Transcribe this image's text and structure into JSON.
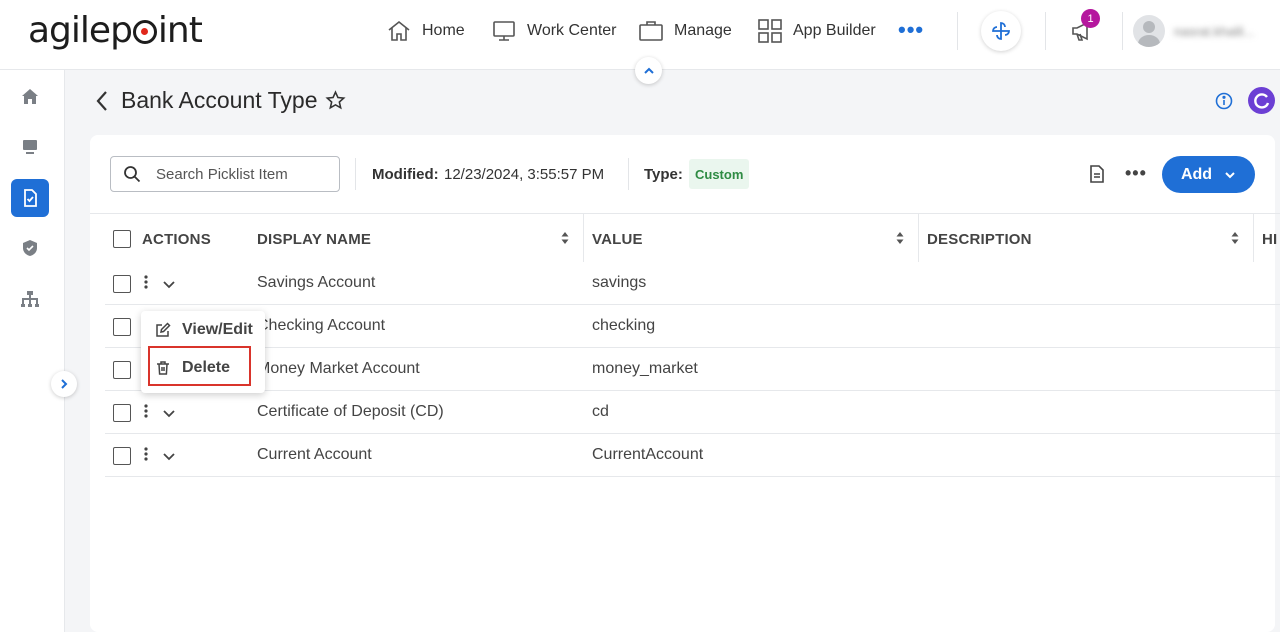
{
  "app": {
    "logo_text": "agilepoint",
    "nav": {
      "home": "Home",
      "work_center": "Work Center",
      "manage": "Manage",
      "app_builder": "App Builder",
      "more": "•••"
    },
    "notification_count": "1",
    "username": "nasrat.khalil..."
  },
  "page": {
    "title": "Bank Account Type",
    "search_placeholder": "Search Picklist Item",
    "modified_label": "Modified:",
    "modified_value": "12/23/2024, 3:55:57 PM",
    "type_label": "Type:",
    "type_value": "Custom",
    "add_label": "Add"
  },
  "table": {
    "headers": {
      "actions": "ACTIONS",
      "display_name": "DISPLAY NAME",
      "value": "VALUE",
      "description": "DESCRIPTION",
      "cutoff": "HI"
    },
    "rows": [
      {
        "display_name": "Savings Account",
        "value": "savings",
        "description": ""
      },
      {
        "display_name": "Checking Account",
        "value": "checking",
        "description": ""
      },
      {
        "display_name": "Money Market Account",
        "value": "money_market",
        "description": ""
      },
      {
        "display_name": "Certificate of Deposit (CD)",
        "value": "cd",
        "description": ""
      },
      {
        "display_name": "Current Account",
        "value": "CurrentAccount",
        "description": ""
      }
    ]
  },
  "action_menu": {
    "view_edit": "View/Edit",
    "delete": "Delete"
  },
  "colors": {
    "accent": "#1f6fd6",
    "refresh": "#6c3fd4",
    "badge": "#b5179e",
    "chip_text": "#2e8b43",
    "highlight": "#d9342b"
  }
}
